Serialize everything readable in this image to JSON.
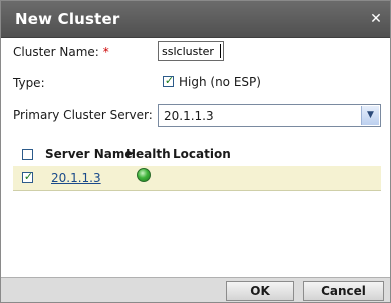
{
  "dialog": {
    "title": "New Cluster",
    "close_glyph": "✕"
  },
  "form": {
    "cluster_name_label": "Cluster Name:",
    "required_marker": "*",
    "cluster_name_value": "sslcluster",
    "type_label": "Type:",
    "type_option_label": "High (no ESP)",
    "type_option_checked": true,
    "primary_server_label": "Primary Cluster Server:",
    "primary_server_value": "20.1.1.3"
  },
  "table": {
    "columns": [
      "Server Name",
      "Health",
      "Location"
    ],
    "rows": [
      {
        "checked": true,
        "server_name": "20.1.1.3",
        "health": "healthy",
        "location": ""
      }
    ]
  },
  "icons": {
    "close": "close-icon",
    "dropdown": "chevron-down-icon",
    "health": "health-status-icon",
    "check": "check-icon"
  },
  "colors": {
    "titlebar": "#5a5a5a",
    "row_highlight": "#f5f2d2",
    "health_ok": "#3fb33a",
    "link": "#1a4a8a",
    "required": "#cc0000"
  },
  "buttons": {
    "ok_label": "OK",
    "cancel_label": "Cancel"
  }
}
